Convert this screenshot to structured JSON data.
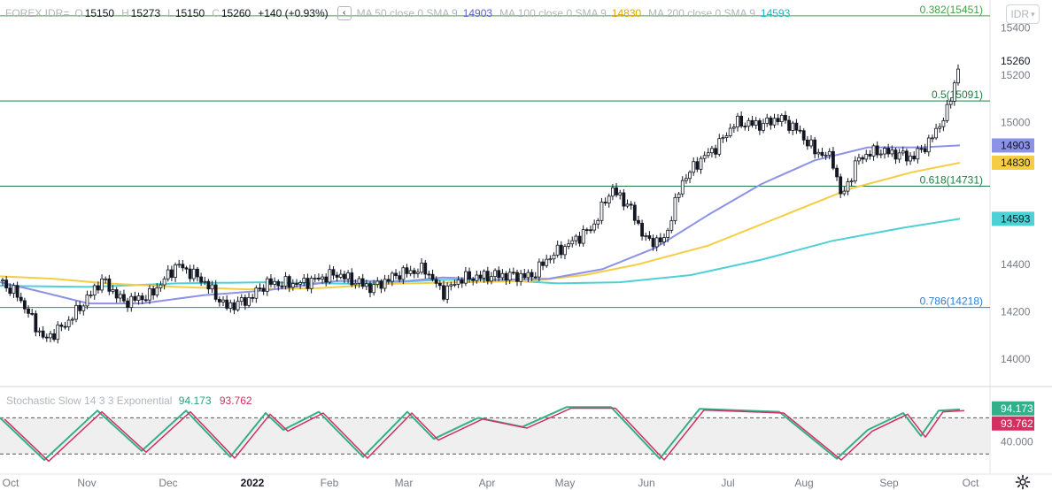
{
  "legend": {
    "symbol": "FOREX IDR=",
    "open_label": "O",
    "open": "15150",
    "high_label": "H",
    "high": "15273",
    "low_label": "L",
    "low": "15150",
    "close_label": "C",
    "close": "15260",
    "change": "+140 (+0.93%)",
    "collapse_icon": "chevron-left-icon",
    "ma50_label": "MA 50 close 0 SMA 9",
    "ma50_value": "14903",
    "ma100_label": "MA 100 close 0 SMA 9",
    "ma100_value": "14830",
    "ma200_label": "MA 200 close 0 SMA 9",
    "ma200_value": "14593"
  },
  "currency_button": {
    "label": "IDR",
    "icon": "chevron-down-icon"
  },
  "stoch_legend": {
    "label": "Stochastic Slow 14 3 3 Exponential",
    "k_value": "94.173",
    "d_value": "93.762"
  },
  "settings_icon": "gear-icon",
  "colors": {
    "up": "#131722",
    "down": "#131722",
    "ma50": "#8c92e6",
    "ma100": "#f5cd44",
    "ma200": "#4dd0d6",
    "fib_618": "#1e7d43",
    "fib_5": "#1e7d43",
    "fib_382": "#43a047",
    "fib_786": "#2f7fd1",
    "stoch_k": "#33b08a",
    "stoch_d": "#d32f60",
    "stoch_band": "#efefef",
    "last_price": "#131722"
  },
  "chart_data": {
    "type": "candlestick",
    "y_ticks": [
      14000,
      14200,
      14400,
      15000,
      15200,
      15400
    ],
    "x_labels": [
      "Oct",
      "Nov",
      "Dec",
      "2022",
      "Feb",
      "Mar",
      "Apr",
      "May",
      "Jun",
      "Jul",
      "Aug",
      "Sep",
      "Oct"
    ],
    "x_label_bold": [
      "2022"
    ],
    "last_price_label": "15260",
    "fib_levels": [
      {
        "label": "0.382(15451)",
        "value": 15451
      },
      {
        "label": "0.5(15091)",
        "value": 15091
      },
      {
        "label": "0.618(14731)",
        "value": 14731
      },
      {
        "label": "0.786(14218)",
        "value": 14218
      }
    ],
    "ma_labels": [
      {
        "name": "MA 50",
        "label": "14903",
        "value": 14903
      },
      {
        "name": "MA 100",
        "label": "14830",
        "value": 14830
      },
      {
        "name": "MA 200",
        "label": "14593",
        "value": 14593
      }
    ],
    "stochastic": {
      "tick_label": "40.000",
      "tick_value": 40,
      "k_last_label": "94.173",
      "d_last_label": "93.762",
      "band_upper": 80,
      "band_lower": 20
    }
  }
}
